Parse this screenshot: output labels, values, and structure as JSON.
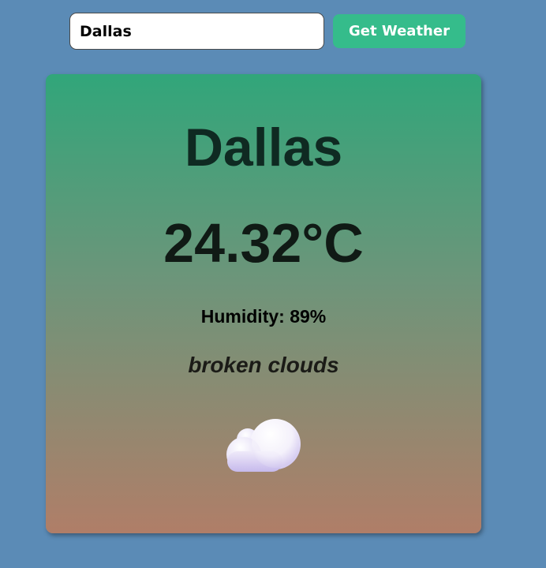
{
  "search": {
    "value": "Dallas",
    "button_label": "Get Weather"
  },
  "weather": {
    "city": "Dallas",
    "temperature": "24.32°C",
    "humidity": "Humidity: 89%",
    "description": "broken clouds",
    "icon": "cloud-icon"
  },
  "colors": {
    "background": "#5b8bb6",
    "button": "#35bc8b",
    "card_top": "#31a67a",
    "card_bottom": "#b07e68"
  }
}
